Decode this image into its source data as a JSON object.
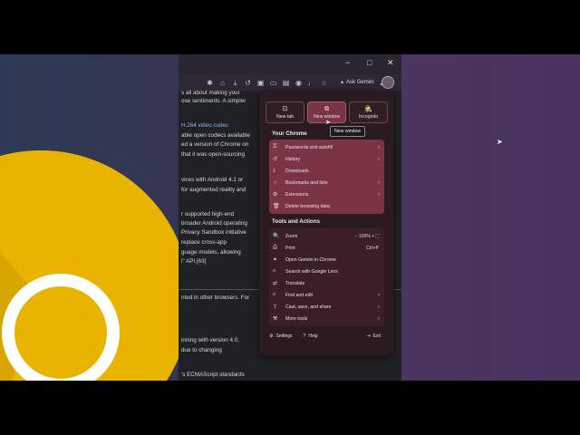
{
  "window": {
    "minimize": "−",
    "maximize": "□",
    "close": "✕"
  },
  "toolbar": {
    "gemini_label": "Ask Gemini"
  },
  "article_lines": [
    {
      "text": "s all about making your",
      "link": false
    },
    {
      "text": "ose sentiments. A simpler",
      "link": false
    },
    {
      "text": "H.264 video codec",
      "link": true
    },
    {
      "text": "able open codecs available",
      "link": false
    },
    {
      "text": "ed a version of Chrome on",
      "link": false
    },
    {
      "text": "that it was open-sourcing",
      "link": false
    },
    {
      "text": "vices with Android 4.1 or",
      "link": false
    },
    {
      "text": "for augmented reality and",
      "link": false
    },
    {
      "text": "r supported high-end",
      "link": false
    },
    {
      "text": "broader Android operating",
      "link": false
    },
    {
      "text": "Privacy Sandbox initiative",
      "link": false
    },
    {
      "text": "replace cross-app",
      "link": false
    },
    {
      "text": "guage models, allowing",
      "link": false
    },
    {
      "text": "i\" API.[63]",
      "link": false
    },
    {
      "text": "nted in other browsers. For",
      "link": false
    },
    {
      "text": "inning with version 4.0,",
      "link": false
    },
    {
      "text": "due to changing",
      "link": false
    },
    {
      "text": "'s ECMAScript standards",
      "link": false
    }
  ],
  "menu": {
    "top_buttons": [
      {
        "label": "New tab",
        "icon": "new-tab-icon",
        "glyph": "⊡"
      },
      {
        "label": "New window",
        "icon": "new-window-icon",
        "glyph": "⧉"
      },
      {
        "label": "Incognito",
        "icon": "incognito-icon",
        "glyph": "🕵"
      }
    ],
    "tooltip": "New window",
    "section1_title": "Your Chrome",
    "section1_items": [
      {
        "label": "Passwords and autofill",
        "glyph": "⚿",
        "chevron": true
      },
      {
        "label": "History",
        "glyph": "↺",
        "chevron": true
      },
      {
        "label": "Downloads",
        "glyph": "⤓",
        "chevron": false
      },
      {
        "label": "Bookmarks and lists",
        "glyph": "☆",
        "chevron": true
      },
      {
        "label": "Extensions",
        "glyph": "⚙",
        "chevron": true
      },
      {
        "label": "Delete browsing data",
        "glyph": "🗑",
        "chevron": false
      }
    ],
    "section2_title": "Tools and Actions",
    "section2_items": [
      {
        "label": "Zoom",
        "glyph": "🔍",
        "extra": "−  100%  +  ⛶"
      },
      {
        "label": "Print",
        "glyph": "⎙",
        "extra": "Ctrl+P"
      },
      {
        "label": "Open Gemini in Chrome",
        "glyph": "✦",
        "extra": ""
      },
      {
        "label": "Search with Google Lens",
        "glyph": "⌕",
        "extra": ""
      },
      {
        "label": "Translate",
        "glyph": "⇄",
        "extra": ""
      },
      {
        "label": "Find and edit",
        "glyph": "⌕",
        "extra": "›"
      },
      {
        "label": "Cast, save, and share",
        "glyph": "⇪",
        "extra": "›"
      },
      {
        "label": "More tools",
        "glyph": "⚒",
        "extra": "›"
      }
    ],
    "settings": "Settings",
    "help": "Help",
    "exit": "Exit"
  },
  "colors": {
    "highlight": "#7b3444",
    "menu_bg": "#2b1b21",
    "link": "#8ab4f8"
  }
}
